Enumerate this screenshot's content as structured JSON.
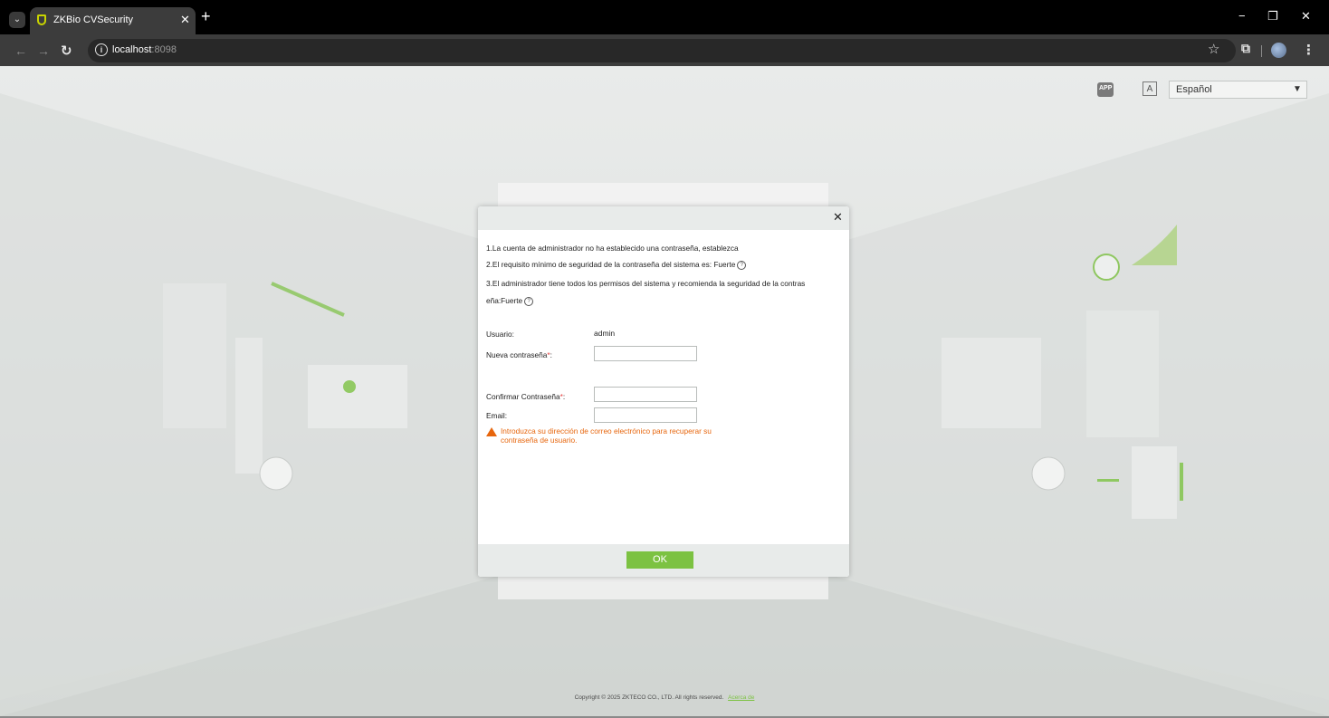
{
  "browser": {
    "tab_title": "ZKBio CVSecurity",
    "url_host": "localhost",
    "url_port": ":8098"
  },
  "header": {
    "app_icon_text": "APP",
    "lang_icon_text": "A",
    "language_selected": "Español"
  },
  "dialog": {
    "notices": [
      "1.La cuenta de administrador no ha establecido una contraseña, establezca",
      "2.El requisito mínimo de seguridad de la contraseña del sistema es: Fuerte",
      "3.El administrador tiene todos los permisos del sistema y recomienda la seguridad de la contras",
      "eña:Fuerte"
    ],
    "username_label": "Usuario",
    "username_value": "admin",
    "new_password_label": "Nueva contraseña",
    "confirm_password_label": "Confirmar Contraseña",
    "email_label": "Email",
    "email_warning": "Introduzca su dirección de correo electrónico para recuperar su contraseña de usuario.",
    "ok_label": "OK"
  },
  "footer": {
    "copyright": "Copyright © 2025 ZKTECO CO., LTD. All rights reserved.",
    "about_link": "Acerca de"
  },
  "colors": {
    "accent": "#7cc242",
    "warning": "#e7660d",
    "required": "#e43f3f"
  }
}
